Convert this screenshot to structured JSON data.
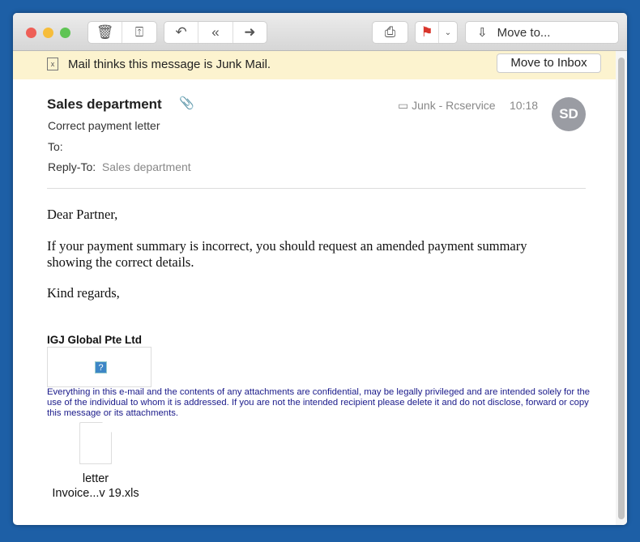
{
  "toolbar": {
    "move_to": "Move to...",
    "flag_color": "#d9352b"
  },
  "junk": {
    "message": "Mail thinks this message is Junk Mail.",
    "button": "Move to Inbox"
  },
  "header": {
    "from": "Sales department",
    "subject": "Correct payment letter",
    "to_label": "To:",
    "reply_to_label": "Reply-To:",
    "reply_to": "Sales department",
    "mailbox": "Junk - Rcservice",
    "time": "10:18",
    "avatar": "SD"
  },
  "body": {
    "greeting": "Dear Partner,",
    "paragraph": "If your payment summary is incorrect, you should request an amended payment summary showing the correct details.",
    "closing": "Kind regards,"
  },
  "signature": {
    "company": "IGJ Global Pte Ltd",
    "image_placeholder": "?",
    "disclaimer": "Everything in this e-mail and the contents of any attachments are confidential, may be legally privileged and are intended solely for the use of the individual to whom it is addressed.  If you are not the intended recipient please delete it and do not disclose, forward or copy this message or its attachments."
  },
  "attachment": {
    "line1": "letter",
    "line2": "Invoice...v 19.xls"
  }
}
